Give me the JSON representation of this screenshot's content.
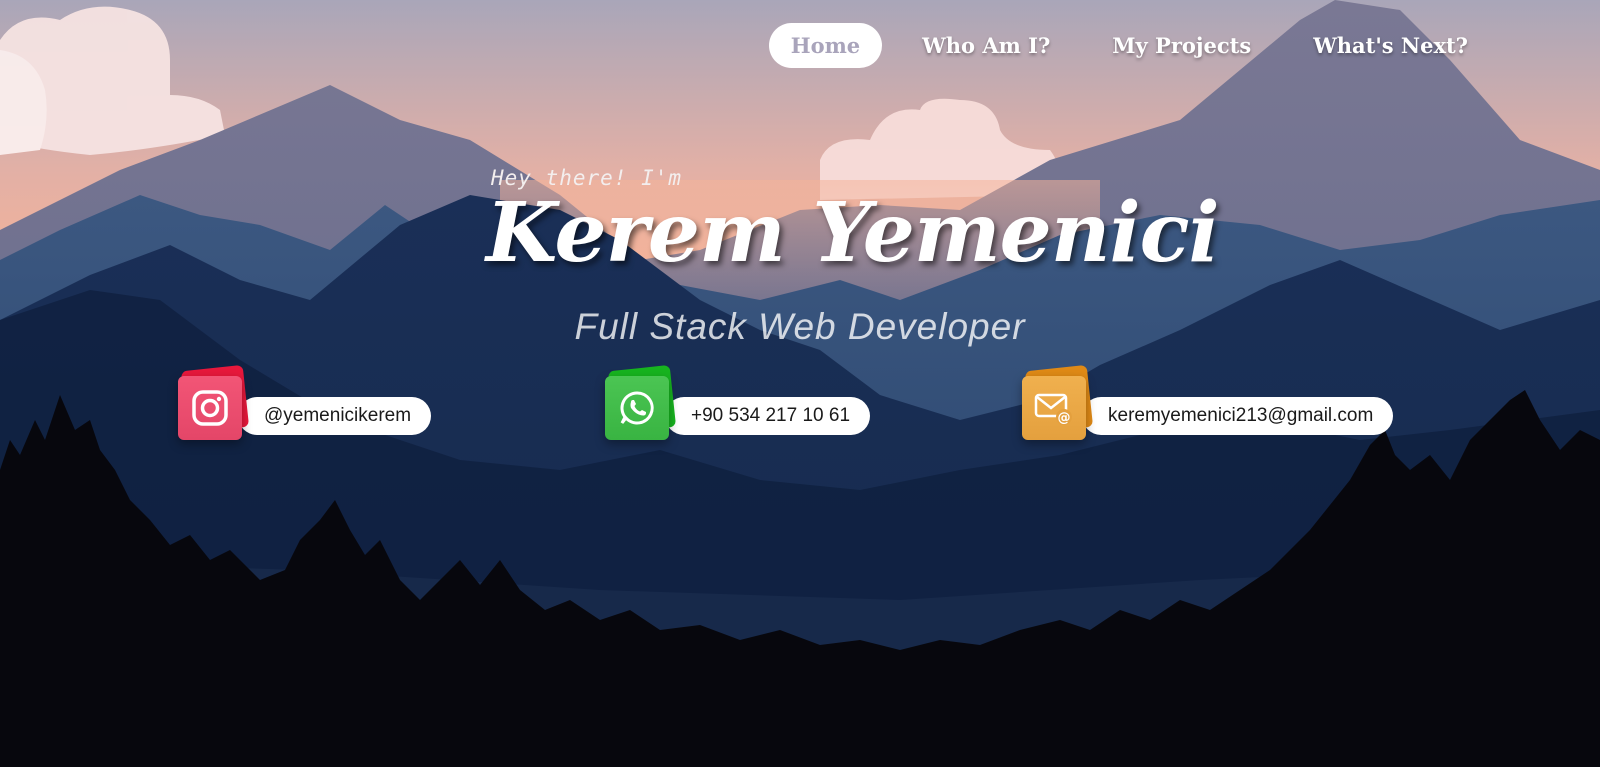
{
  "nav": {
    "items": [
      {
        "label": "Home",
        "active": true
      },
      {
        "label": "Who Am I?",
        "active": false
      },
      {
        "label": "My Projects",
        "active": false
      },
      {
        "label": "What's Next?",
        "active": false
      }
    ]
  },
  "hero": {
    "greeting": "Hey there! I'm",
    "name": "Kerem Yemenici",
    "role": "Full Stack Web Developer"
  },
  "contacts": [
    {
      "icon": "instagram-icon",
      "text": "@yemenicikerem",
      "color": "#e8183c"
    },
    {
      "icon": "whatsapp-icon",
      "text": "+90 534 217 10 61",
      "color": "#17b41f"
    },
    {
      "icon": "mail-icon",
      "text": "keremyemenici213@gmail.com",
      "color": "#e08a16"
    }
  ],
  "colors": {
    "sky_top": "#aaa7b9",
    "sky_glow": "#f6b49a",
    "mountain_far": "#6b6f91",
    "mountain_mid": "#2e4a72",
    "forest": "#08080f"
  }
}
